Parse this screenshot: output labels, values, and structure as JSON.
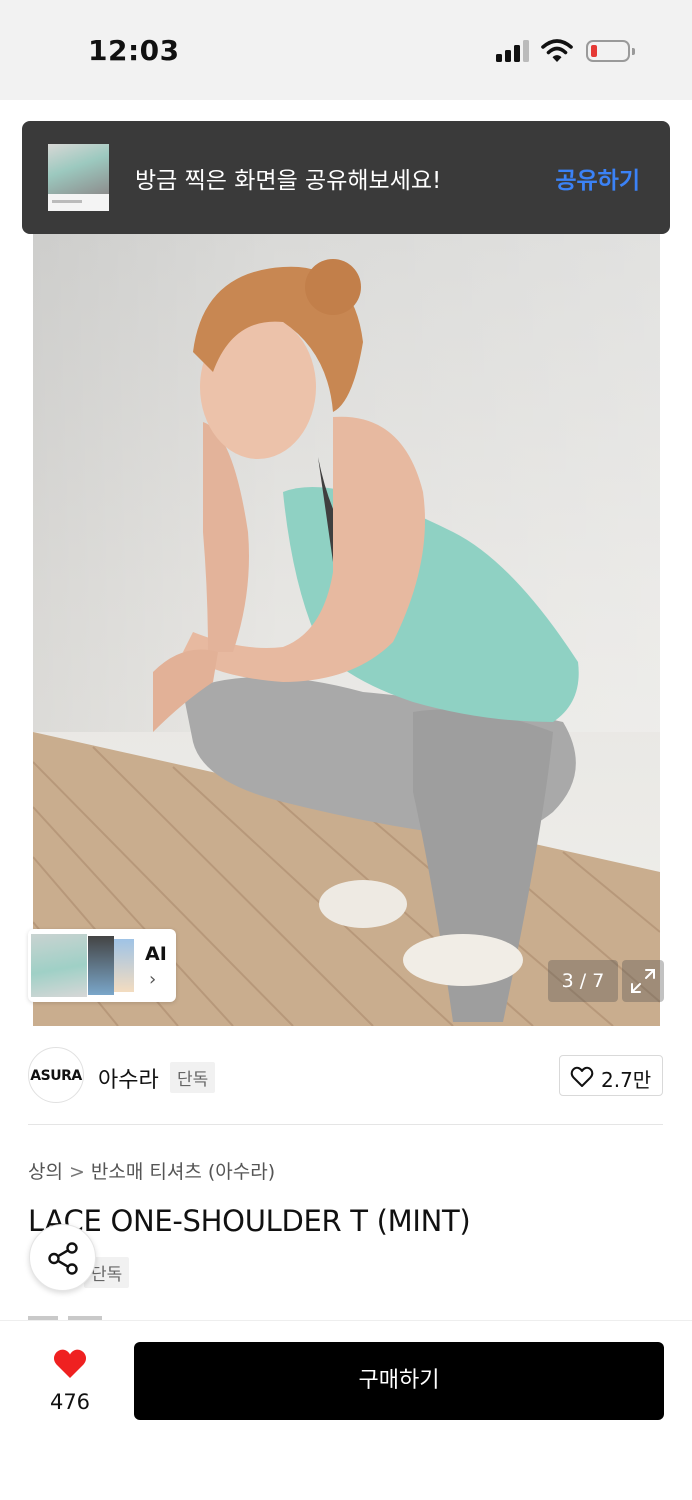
{
  "status_bar": {
    "time": "12:03"
  },
  "share_toast": {
    "message": "방금 찍은 화면을 공유해보세요!",
    "action_label": "공유하기",
    "action_color": "#3b82f6"
  },
  "gallery": {
    "ai_label": "AI",
    "ai_chevron": "›",
    "counter": "3 / 7"
  },
  "brand": {
    "logo_text": "ASURA",
    "name": "아수라",
    "exclusive_badge": "단독",
    "like_count": "2.7만"
  },
  "breadcrumb": {
    "category": "상의",
    "separator": ">",
    "subcategory": "반소매 티셔츠 (아수라)"
  },
  "product": {
    "title": "LACE ONE-SHOULDER T (MINT)",
    "exclusive_badge": "단독"
  },
  "bottom_bar": {
    "wish_count": "476",
    "buy_label": "구매하기",
    "wish_color": "#ef2121"
  },
  "icons": [
    "signal-icon",
    "wifi-icon",
    "battery-icon",
    "expand-icon",
    "heart-outline-icon",
    "share-icon",
    "heart-filled-icon"
  ]
}
